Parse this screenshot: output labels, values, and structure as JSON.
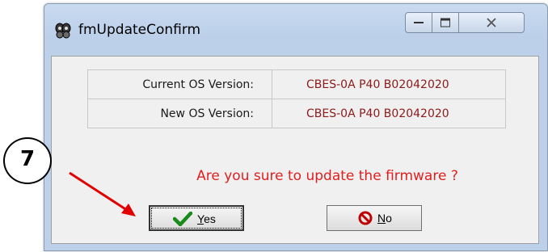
{
  "window": {
    "title": "fmUpdateConfirm",
    "icon": "butterfly-app-icon",
    "controls": [
      "minimize-icon",
      "maximize-icon",
      "close-icon"
    ]
  },
  "info": {
    "rows": [
      {
        "label": "Current OS Version:",
        "value": "CBES-0A P40 B02042020"
      },
      {
        "label": "New OS Version:",
        "value": "CBES-0A P40 B02042020"
      }
    ]
  },
  "question": "Are you sure to update the firmware ?",
  "buttons": {
    "yes_label": "Yes",
    "no_label": "No"
  },
  "annotation": {
    "step_number": "7",
    "color": "#e00000"
  },
  "colors": {
    "question_text": "#e02020",
    "value_text": "#8b1a1a"
  }
}
